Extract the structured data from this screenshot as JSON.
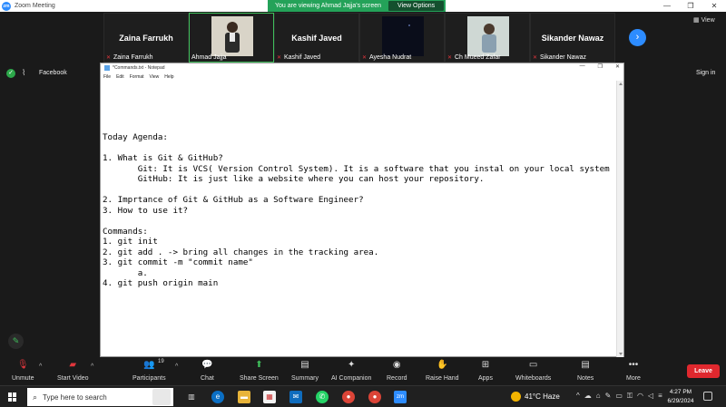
{
  "window": {
    "title": "Zoom Meeting",
    "logo_text": "zm"
  },
  "share_banner": {
    "text": "You are viewing Ahmad Jajja's screen",
    "options_label": "View Options"
  },
  "participants": [
    {
      "big_name": "Zaina Farrukh",
      "label": "Zaina Farrukh",
      "muted": true,
      "video": false
    },
    {
      "big_name": "",
      "label": "Ahmad Jajja",
      "muted": false,
      "video": true,
      "active": true
    },
    {
      "big_name": "Kashif Javed",
      "label": "Kashif Javed",
      "muted": true,
      "video": false
    },
    {
      "big_name": "",
      "label": "Ayesha Nudrat",
      "muted": true,
      "video": true
    },
    {
      "big_name": "",
      "label": "Ch Mueed Zafar",
      "muted": true,
      "video": true
    },
    {
      "big_name": "Sikander Nawaz",
      "label": "Sikander Nawaz",
      "muted": true,
      "video": false
    }
  ],
  "view_label": "View",
  "left_bar": {
    "facebook_label": "Facebook",
    "sign_in_label": "Sign in"
  },
  "notepad": {
    "title": "*Commands.txt - Notepad",
    "menu": [
      "File",
      "Edit",
      "Format",
      "View",
      "Help"
    ],
    "content": "Today Agenda:\n\n1. What is Git & GitHub?\n       Git: It is VCS( Version Control System). It is a software that you instal on your local system\n       GitHub: It is just like a website where you can host your repository.\n\n2. Imprtance of Git & GitHub as a Software Engineer?\n3. How to use it?\n\nCommands:\n1. git init\n2. git add . -> bring all changes in the tracking area.\n3. git commit -m \"commit name\"\n       a.\n4. git push origin main"
  },
  "toolbar": {
    "unmute": "Unmute",
    "start_video": "Start Video",
    "participants": "Participants",
    "participants_count": "19",
    "chat": "Chat",
    "share_screen": "Share Screen",
    "summary": "Summary",
    "ai_companion": "AI Companion",
    "record": "Record",
    "raise_hand": "Raise Hand",
    "apps": "Apps",
    "whiteboards": "Whiteboards",
    "notes": "Notes",
    "more": "More",
    "leave": "Leave"
  },
  "taskbar": {
    "search_placeholder": "Type here to search",
    "weather": "41°C  Haze",
    "time": "4:27 PM",
    "date": "6/29/2024"
  },
  "colors": {
    "zoom_blue": "#2d8cff",
    "share_green": "#24a259",
    "leave_red": "#e0282e",
    "active_border": "#3fbf5b"
  }
}
